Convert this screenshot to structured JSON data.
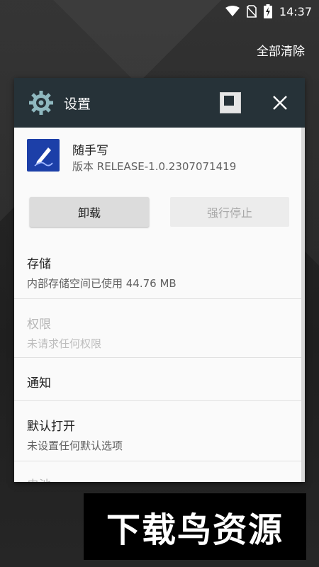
{
  "status_bar": {
    "time": "14:37",
    "icons": [
      "wifi-icon",
      "no-sim-icon",
      "battery-charging-icon"
    ]
  },
  "recents": {
    "clear_all_label": "全部清除"
  },
  "card": {
    "title": "设置",
    "header_icon": "gear-icon",
    "header_color": "#263238",
    "app": {
      "name": "随手写",
      "version": "版本 RELEASE-1.0.2307071419",
      "icon": "pen-icon",
      "icon_color": "#1c3fa8"
    },
    "buttons": {
      "uninstall": "卸载",
      "force_stop": "强行停止"
    },
    "sections": [
      {
        "title": "存储",
        "subtitle": "内部存储空间已使用 44.76 MB",
        "enabled": true
      },
      {
        "title": "权限",
        "subtitle": "未请求任何权限",
        "enabled": false
      },
      {
        "title": "通知",
        "subtitle": "",
        "enabled": true
      },
      {
        "title": "默认打开",
        "subtitle": "未设置任何默认选项",
        "enabled": true
      },
      {
        "title": "电池",
        "subtitle": "",
        "enabled": false
      }
    ]
  },
  "watermark": {
    "text": "下载鸟资源"
  }
}
